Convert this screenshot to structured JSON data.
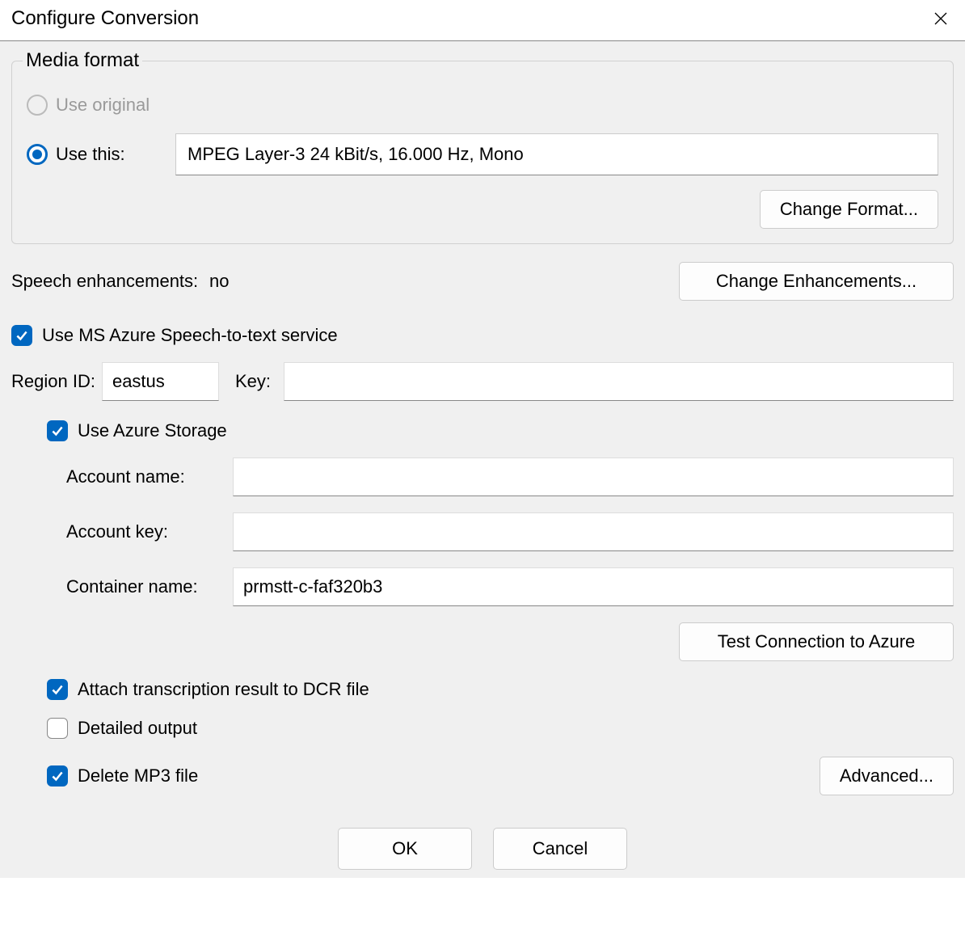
{
  "window": {
    "title": "Configure Conversion"
  },
  "media_format": {
    "legend": "Media format",
    "use_original_label": "Use original",
    "use_this_label": "Use this:",
    "format_value": "MPEG Layer-3 24 kBit/s, 16.000 Hz, Mono",
    "change_format_label": "Change Format..."
  },
  "speech": {
    "label": "Speech enhancements:",
    "value": "no",
    "change_label": "Change Enhancements..."
  },
  "azure": {
    "use_stt_label": "Use MS Azure Speech-to-text service",
    "region_label": "Region ID:",
    "region_value": "eastus",
    "key_label": "Key:",
    "key_value": "",
    "use_storage_label": "Use Azure Storage",
    "account_name_label": "Account name:",
    "account_name_value": "",
    "account_key_label": "Account key:",
    "account_key_value": "",
    "container_label": "Container name:",
    "container_value": "prmstt-c-faf320b3",
    "test_label": "Test Connection to Azure",
    "attach_label": "Attach transcription result to DCR file",
    "detailed_label": "Detailed output",
    "delete_label": "Delete MP3 file",
    "advanced_label": "Advanced..."
  },
  "footer": {
    "ok": "OK",
    "cancel": "Cancel"
  }
}
